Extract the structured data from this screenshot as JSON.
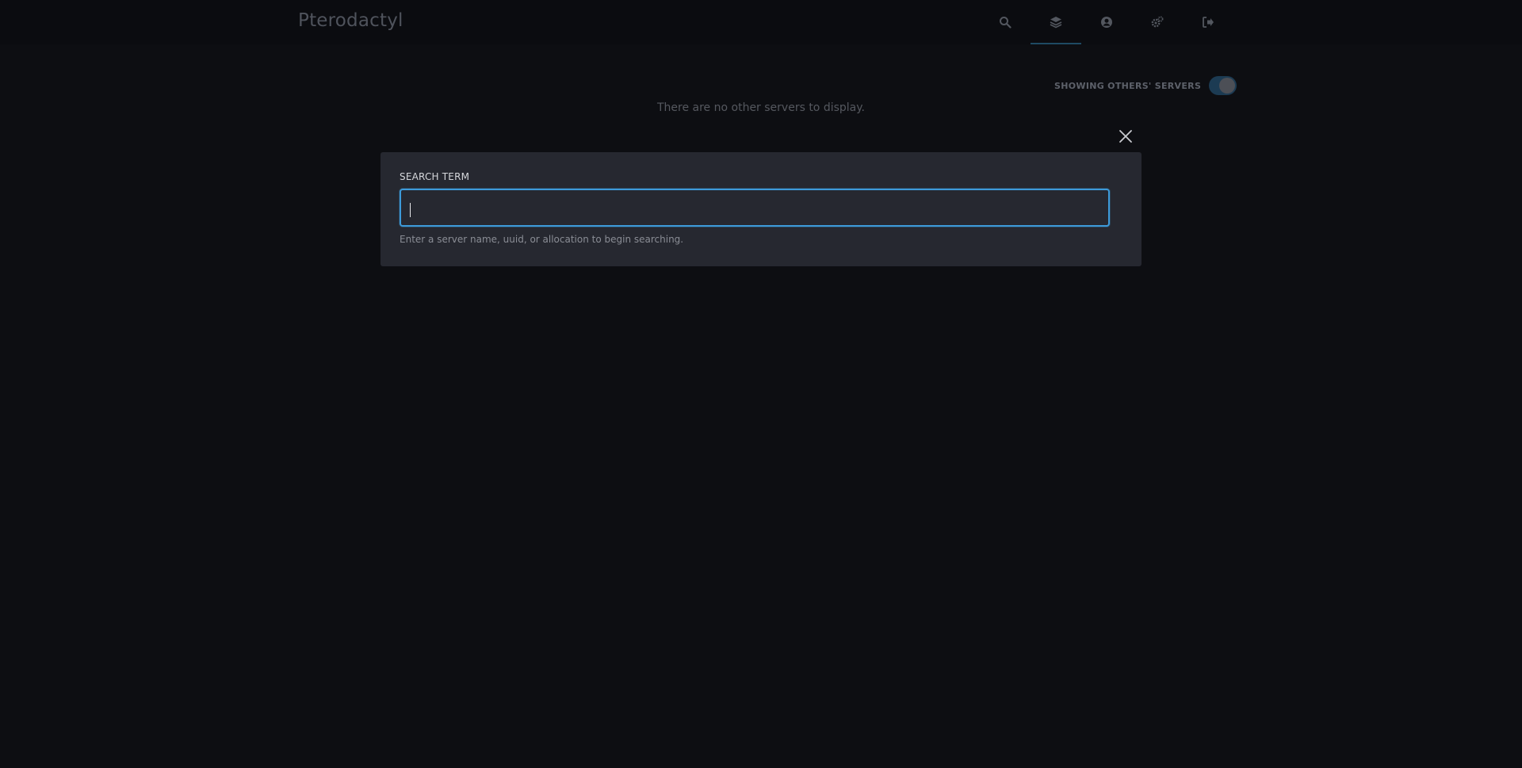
{
  "app": {
    "brand": "Pterodactyl"
  },
  "nav": {
    "items": [
      {
        "icon": "search-icon",
        "active": false
      },
      {
        "icon": "layers-icon",
        "active": true
      },
      {
        "icon": "user-circle-icon",
        "active": false
      },
      {
        "icon": "cogs-icon",
        "active": false
      },
      {
        "icon": "sign-out-icon",
        "active": false
      }
    ]
  },
  "servers": {
    "toggle_label": "SHOWING OTHERS' SERVERS",
    "toggle_on": true,
    "empty_message": "There are no other servers to display."
  },
  "search_modal": {
    "label": "SEARCH TERM",
    "value": "",
    "helper": "Enter a server name, uuid, or allocation to begin searching."
  },
  "colors": {
    "accent": "#3d9ad9",
    "modal_bg": "#262830",
    "page_bg": "#0d0e12"
  }
}
